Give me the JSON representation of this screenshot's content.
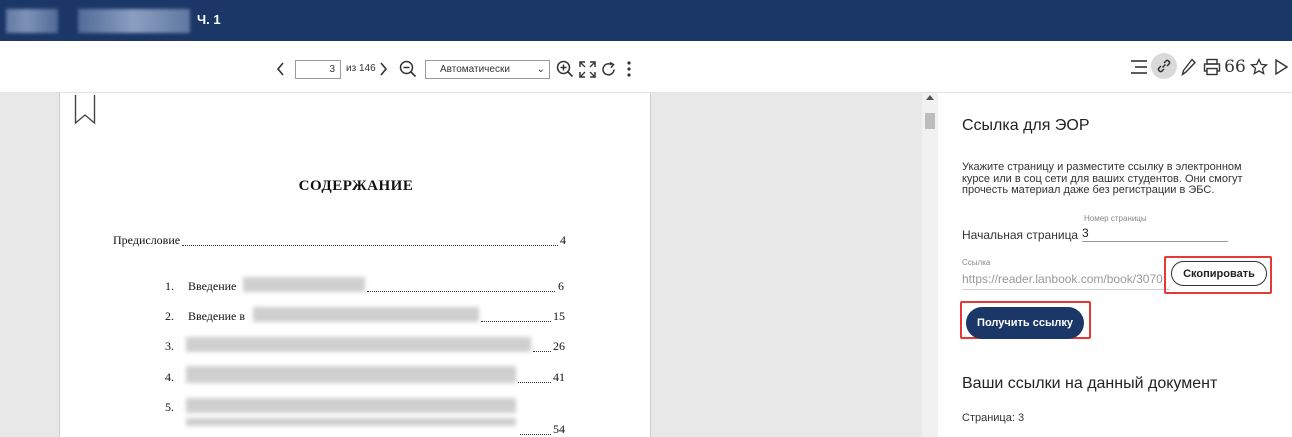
{
  "header": {
    "title": "Ч. 1"
  },
  "toolbar": {
    "current_page": "3",
    "page_of": "из 146",
    "zoom": "Автоматически",
    "icons": [
      "chevron-left-icon",
      "chevron-right-icon",
      "zoom-out-icon",
      "zoom-in-icon",
      "fullscreen-icon",
      "rotate-icon",
      "more-vertical-icon",
      "list-icon",
      "link-icon",
      "pen-icon",
      "print-icon",
      "quote-icon",
      "star-icon",
      "send-icon"
    ]
  },
  "document": {
    "toc_title": "СОДЕРЖАНИЕ",
    "entries": [
      {
        "number": "",
        "text": "Предисловие",
        "page": "4"
      },
      {
        "number": "1.",
        "text": "Введение",
        "page": "6"
      },
      {
        "number": "2.",
        "text": "Введение в",
        "page": "15"
      },
      {
        "number": "3.",
        "text": "",
        "page": "26"
      },
      {
        "number": "4.",
        "text": "",
        "page": "41"
      },
      {
        "number": "5.",
        "text": "",
        "page": "54"
      }
    ]
  },
  "panel": {
    "heading": "Ссылка для ЭОР",
    "description": "Укажите страницу и разместите ссылку в электронном курсе или в соц сети для ваших студентов. Они смогут прочесть материал даже без регистрации в ЭБС.",
    "page_number_label": "Номер страницы",
    "start_page_label": "Начальная страница",
    "start_page_value": "3",
    "link_label": "Ссылка",
    "link_value": "https://reader.lanbook.com/book/3070",
    "copy_button": "Скопировать",
    "get_link_button": "Получить ссылку",
    "links_heading": "Ваши ссылки на данный документ",
    "page_ref": "Страница: 3"
  },
  "colors": {
    "brand": "#1b3768",
    "highlight": "#e53935"
  }
}
